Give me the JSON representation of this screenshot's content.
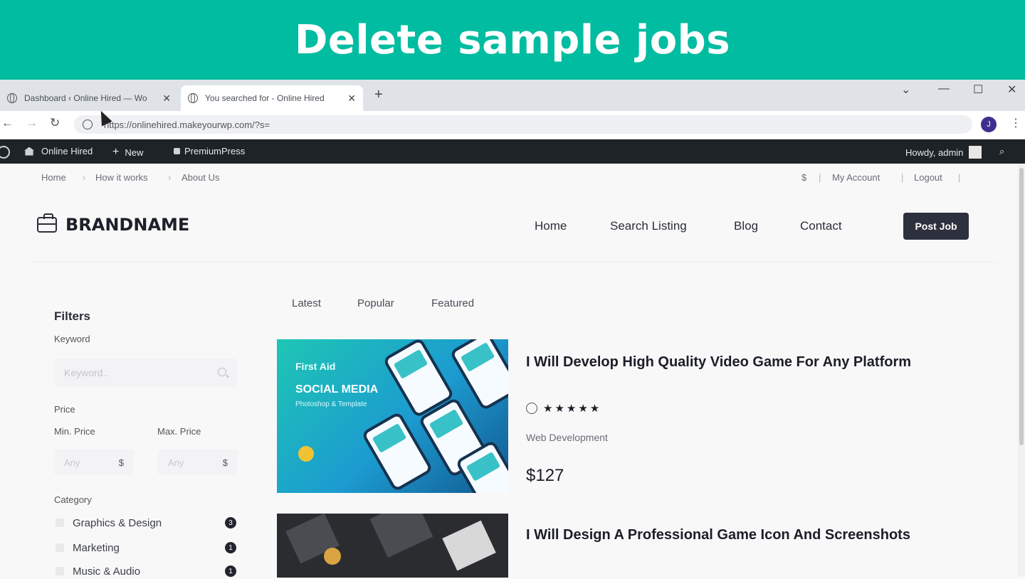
{
  "banner": {
    "title": "Delete sample jobs"
  },
  "browser": {
    "tabs": [
      {
        "title": "Dashboard ‹ Online Hired — Wo"
      },
      {
        "title": "You searched for - Online Hired"
      }
    ],
    "url": "https://onlinehired.makeyourwp.com/?s=",
    "profile_initial": "J"
  },
  "adminbar": {
    "site_name": "Online Hired",
    "new_label": "New",
    "plugin_label": "PremiumPress",
    "howdy": "Howdy, admin"
  },
  "site": {
    "topnav": {
      "home": "Home",
      "how": "How it works",
      "about": "About Us",
      "currency": "$",
      "account": "My Account",
      "logout": "Logout"
    },
    "brand": "BRANDNAME",
    "mainnav": {
      "home": "Home",
      "search": "Search Listing",
      "blog": "Blog",
      "contact": "Contact"
    },
    "post_job": "Post Job"
  },
  "filters": {
    "title": "Filters",
    "keyword_label": "Keyword",
    "keyword_placeholder": "Keyword..",
    "price_label": "Price",
    "min_label": "Min. Price",
    "max_label": "Max. Price",
    "min_placeholder": "Any",
    "max_placeholder": "Any",
    "currency": "$",
    "category_label": "Category",
    "categories": [
      {
        "name": "Graphics & Design",
        "count": "3"
      },
      {
        "name": "Marketing",
        "count": "1"
      },
      {
        "name": "Music & Audio",
        "count": "1"
      }
    ]
  },
  "listings": {
    "sort_tabs": [
      "Latest",
      "Popular",
      "Featured"
    ],
    "items": [
      {
        "title": "I Will Develop High Quality Video Game For Any Platform",
        "stars": "★★★★★",
        "category": "Web Development",
        "price": "$127",
        "thumb_text": {
          "brand": "First Aid",
          "headline": "SOCIAL MEDIA",
          "sub": "Photoshop & Template"
        }
      },
      {
        "title": "I Will Design A Professional Game Icon And Screenshots"
      }
    ]
  }
}
